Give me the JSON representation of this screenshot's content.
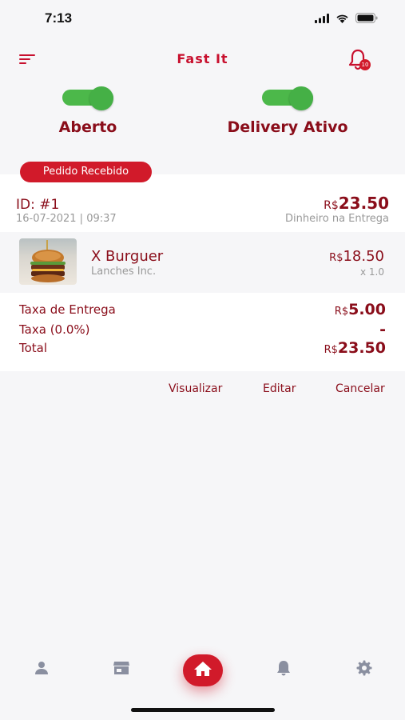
{
  "status_bar": {
    "time": "7:13"
  },
  "header": {
    "title": "Fast It",
    "notification_count": "10"
  },
  "toggles": [
    {
      "label": "Aberto",
      "on": true
    },
    {
      "label": "Delivery Ativo",
      "on": true
    }
  ],
  "order": {
    "status": "Pedido Recebido",
    "id": "ID: #1",
    "date": "16-07-2021 | 09:37",
    "currency": "R$",
    "total": "23.50",
    "payment": "Dinheiro na Entrega",
    "item": {
      "name": "X Burguer",
      "store": "Lanches Inc.",
      "price": "18.50",
      "qty": "x 1.0"
    },
    "fees": [
      {
        "label": "Taxa de Entrega",
        "value": "5.00",
        "currency": "R$"
      },
      {
        "label": "Taxa (0.0%)",
        "value": "-",
        "currency": ""
      },
      {
        "label": "Total",
        "value": "23.50",
        "currency": "R$"
      }
    ]
  },
  "actions": {
    "view": "Visualizar",
    "edit": "Editar",
    "cancel": "Cancelar"
  },
  "tabs": [
    {
      "icon": "person-icon"
    },
    {
      "icon": "store-icon"
    },
    {
      "icon": "home-icon",
      "active": true
    },
    {
      "icon": "bell-icon"
    },
    {
      "icon": "gear-icon"
    }
  ],
  "colors": {
    "brand": "#c8102e",
    "dark_red": "#8a0d1a",
    "toggle_green": "#4cb84a",
    "muted": "#999999"
  }
}
